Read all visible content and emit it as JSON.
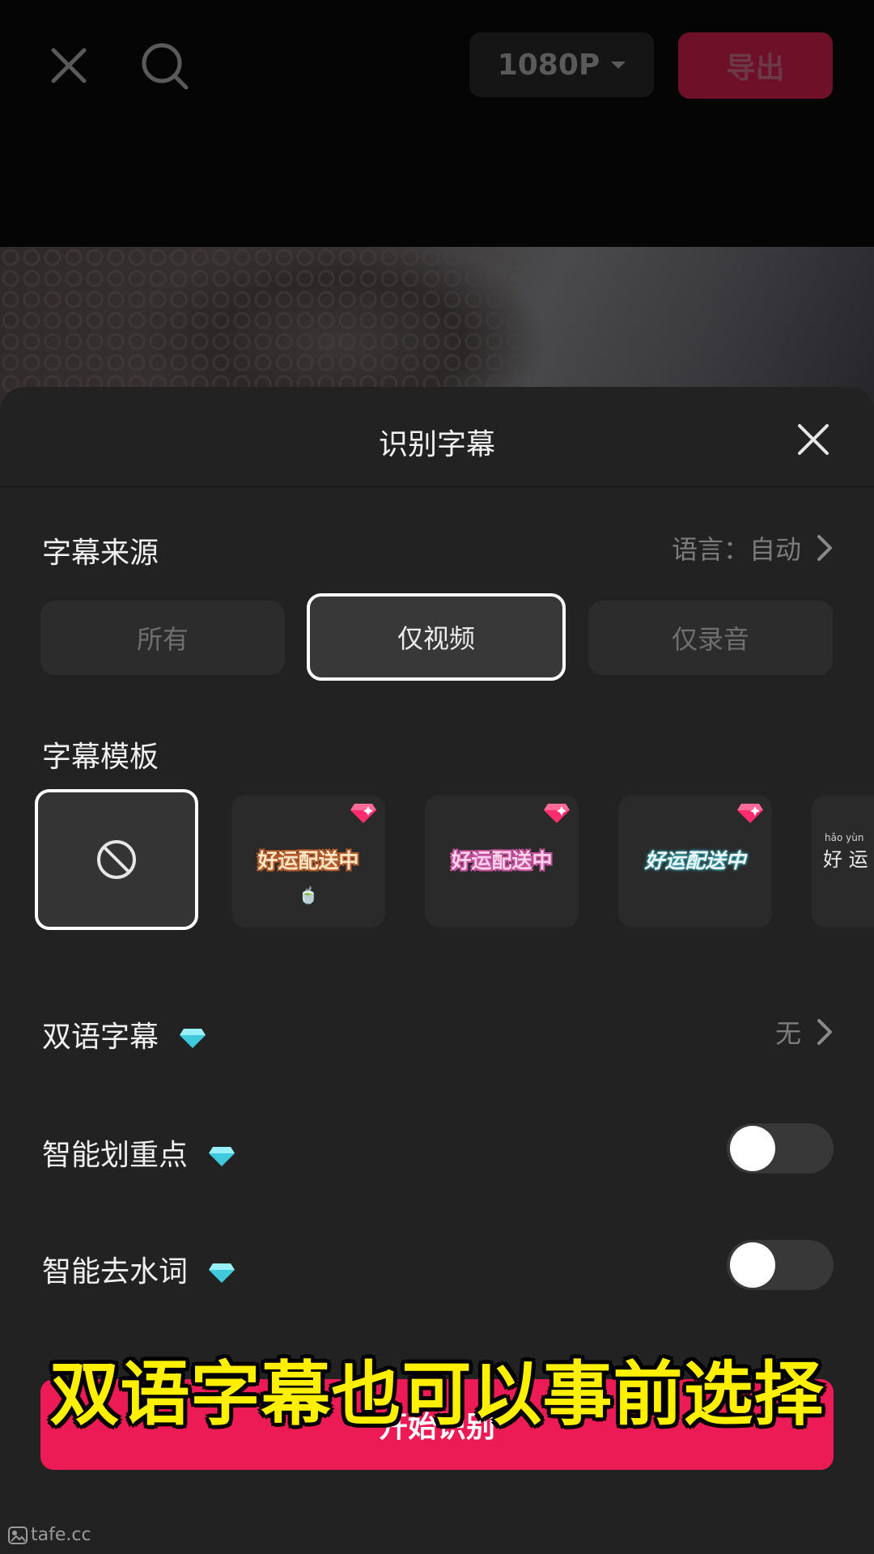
{
  "topbar": {
    "resolution_label": "1080P",
    "export_label": "导出"
  },
  "sheet": {
    "title": "识别字幕",
    "source": {
      "label": "字幕来源",
      "language_label": "语言：自动",
      "options": [
        "所有",
        "仅视频",
        "仅录音"
      ],
      "selected": "仅视频"
    },
    "template": {
      "label": "字幕模板",
      "sample_text": "好运配送中",
      "pinyin_text": "hǎo yùn",
      "pinyin_chars": "好 运",
      "emoji": "🍵"
    },
    "bilingual": {
      "label": "双语字幕",
      "value": "无"
    },
    "highlight": {
      "label": "智能划重点",
      "enabled": false
    },
    "filler": {
      "label": "智能去水词",
      "enabled": false
    },
    "start_label": "开始识别"
  },
  "overlay_caption": "双语字幕也可以事前选择",
  "watermark": "tafe.cc",
  "colors": {
    "accent": "#ec1a55",
    "caption": "#ffef00",
    "premium_gem": "#4fd9e8"
  }
}
